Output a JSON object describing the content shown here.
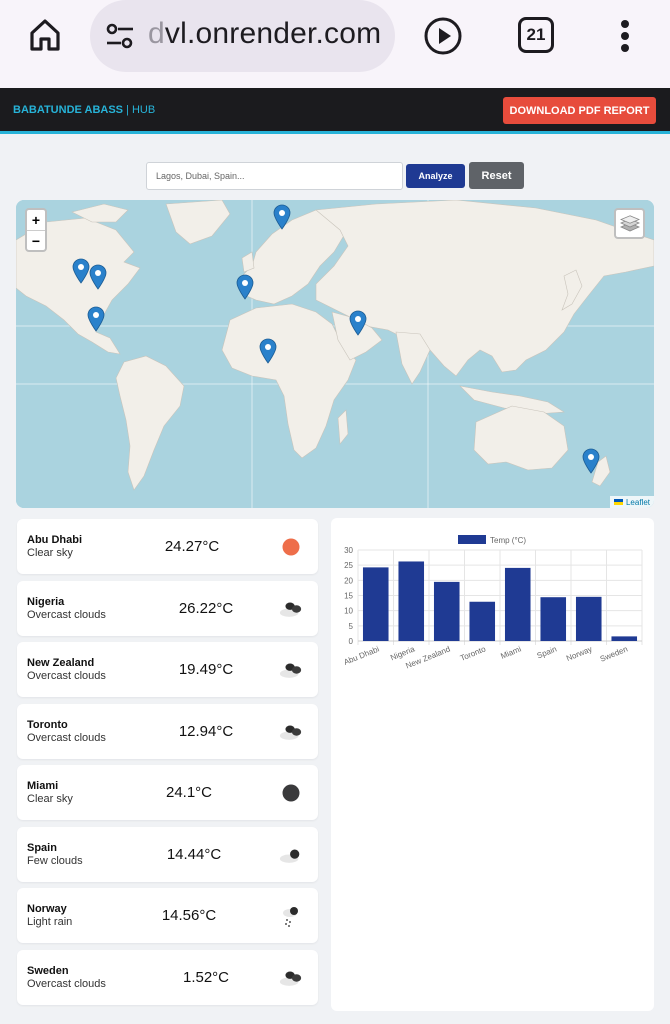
{
  "browser": {
    "url_faded": "d",
    "url_main": "vl.onrender.com",
    "tab_count": "21"
  },
  "header": {
    "brand_name": "BABATUNDE ABASS",
    "brand_sep": " | ",
    "brand_suffix": "HUB",
    "pdf_button": "DOWNLOAD PDF REPORT"
  },
  "search": {
    "placeholder": "Lagos, Dubai, Spain...",
    "analyze_label": "Analyze",
    "reset_label": "Reset"
  },
  "map": {
    "zoom_in": "+",
    "zoom_out": "−",
    "attribution": "Leaflet"
  },
  "weather": [
    {
      "city": "Abu Dhabi",
      "desc": "Clear sky",
      "temp": "24.27°C",
      "icon": "sun-icon"
    },
    {
      "city": "Nigeria",
      "desc": "Overcast clouds",
      "temp": "26.22°C",
      "icon": "overcast-clouds-icon"
    },
    {
      "city": "New Zealand",
      "desc": "Overcast clouds",
      "temp": "19.49°C",
      "icon": "overcast-clouds-icon"
    },
    {
      "city": "Toronto",
      "desc": "Overcast clouds",
      "temp": "12.94°C",
      "icon": "overcast-clouds-icon"
    },
    {
      "city": "Miami",
      "desc": "Clear sky",
      "temp": "24.1°C",
      "icon": "moon-icon"
    },
    {
      "city": "Spain",
      "desc": "Few clouds",
      "temp": "14.44°C",
      "icon": "few-clouds-icon"
    },
    {
      "city": "Norway",
      "desc": "Light rain",
      "temp": "14.56°C",
      "icon": "light-rain-icon"
    },
    {
      "city": "Sweden",
      "desc": "Overcast clouds",
      "temp": "1.52°C",
      "icon": "overcast-clouds-icon"
    }
  ],
  "chart_data": {
    "type": "bar",
    "categories": [
      "Abu Dhabi",
      "Nigeria",
      "New Zealand",
      "Toronto",
      "Miami",
      "Spain",
      "Norway",
      "Sweden"
    ],
    "series": [
      {
        "name": "Temp (°C)",
        "values": [
          24.27,
          26.22,
          19.49,
          12.94,
          24.1,
          14.44,
          14.56,
          1.52
        ],
        "color": "#1f3a93"
      }
    ],
    "yticks": [
      "0",
      "5",
      "10",
      "15",
      "20",
      "25",
      "30"
    ],
    "ylim": [
      0,
      30
    ],
    "grid": true,
    "legend": "top"
  },
  "colors": {
    "accent": "#27b3d8",
    "danger": "#e74c3c",
    "primary": "#1f3a93",
    "sun": "#ee6e4a",
    "moon": "#3a3a3c"
  }
}
